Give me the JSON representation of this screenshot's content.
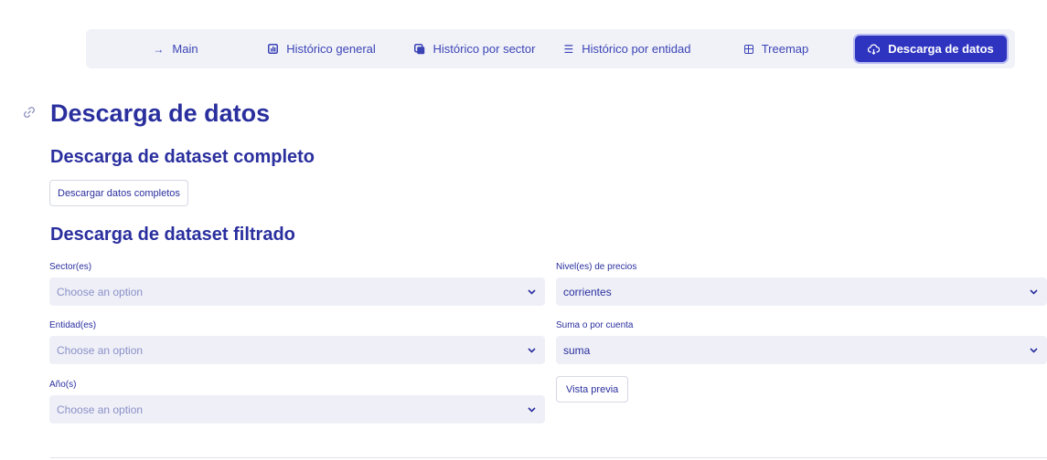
{
  "nav": {
    "items": [
      {
        "label": "Main",
        "icon": "arrow-right-icon"
      },
      {
        "label": "Histórico general",
        "icon": "bar-chart-icon"
      },
      {
        "label": "Histórico por sector",
        "icon": "layers-icon"
      },
      {
        "label": "Histórico por entidad",
        "icon": "list-icon"
      },
      {
        "label": "Treemap",
        "icon": "grid-icon"
      },
      {
        "label": "Descarga de datos",
        "icon": "cloud-download-icon",
        "active": true
      }
    ]
  },
  "page": {
    "title": "Descarga de datos",
    "full_section_title": "Descarga de dataset completo",
    "full_download_button": "Descargar datos completos",
    "filtered_section_title": "Descarga de dataset filtrado"
  },
  "filters": {
    "sector": {
      "label": "Sector(es)",
      "placeholder": "Choose an option"
    },
    "entidad": {
      "label": "Entidad(es)",
      "placeholder": "Choose an option"
    },
    "anio": {
      "label": "Año(s)",
      "placeholder": "Choose an option"
    },
    "nivel": {
      "label": "Nivel(es) de precios",
      "value": "corrientes"
    },
    "suma": {
      "label": "Suma o por cuenta",
      "value": "suma"
    },
    "preview_button": "Vista previa"
  },
  "colors": {
    "primary": "#2f34c0",
    "heading": "#2a2f9e",
    "input_bg": "#eff0f7",
    "nav_bg": "#f1f2f8"
  }
}
